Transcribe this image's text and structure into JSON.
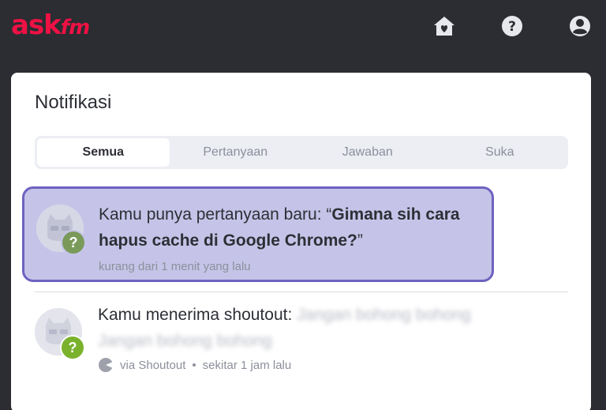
{
  "header": {
    "logo_main": "ask",
    "logo_suffix": "fm",
    "icons": [
      "home-icon",
      "help-icon",
      "profile-icon"
    ]
  },
  "page": {
    "title": "Notifikasi"
  },
  "tabs": [
    {
      "label": "Semua",
      "active": true
    },
    {
      "label": "Pertanyaan",
      "active": false
    },
    {
      "label": "Jawaban",
      "active": false
    },
    {
      "label": "Suka",
      "active": false
    }
  ],
  "notifications": [
    {
      "prefix": "Kamu punya pertanyaan baru: “",
      "highlight": "Gimana sih cara hapus cache di Google Chrome?",
      "suffix": "”",
      "time": "kurang dari 1 menit yang lalu",
      "badge": "?"
    },
    {
      "prefix": "Kamu menerima shoutout:",
      "blurred_1": "Jangan bohong bohong",
      "blurred_2": "Jangan bohong bohong",
      "source": "via Shoutout",
      "separator": "•",
      "time": "sekitar 1 jam lalu",
      "badge": "?"
    }
  ],
  "colors": {
    "brand": "#ee1144",
    "background": "#2b2d32",
    "highlight_fill": "#c5c4e8",
    "highlight_border": "#6d62c0",
    "badge": "#7ab22d"
  }
}
